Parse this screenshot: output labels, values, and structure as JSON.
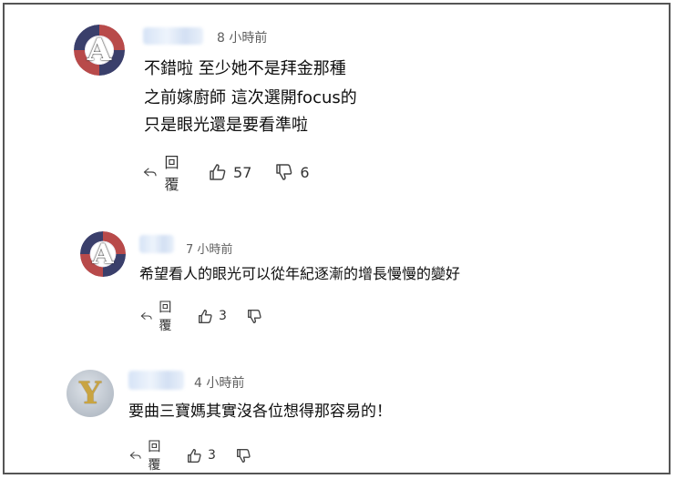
{
  "comments": [
    {
      "avatar_letter": "A",
      "time": "8 小時前",
      "lines": [
        "不錯啦 至少她不是拜金那種",
        "之前嫁廚師 這次選開focus的",
        "只是眼光還是要看準啦"
      ],
      "reply_label": "回覆",
      "likes": "57",
      "dislikes": "6"
    },
    {
      "avatar_letter": "A",
      "time": "7 小時前",
      "lines": [
        "希望看人的眼光可以從年紀逐漸的增長慢慢的變好"
      ],
      "reply_label": "回覆",
      "likes": "3"
    },
    {
      "avatar_letter": "Y",
      "time": "4 小時前",
      "lines": [
        "要曲三寶媽其實沒各位想得那容易的！"
      ],
      "reply_label": "回覆",
      "likes": "3"
    }
  ],
  "icons": {
    "reply": "reply-arrow-icon",
    "like": "thumbs-up-icon",
    "dislike": "thumbs-down-icon"
  },
  "colors": {
    "avatar_red": "#b84a4a",
    "avatar_navy": "#3a3f6b",
    "avatar_gold": "#c9a441"
  }
}
